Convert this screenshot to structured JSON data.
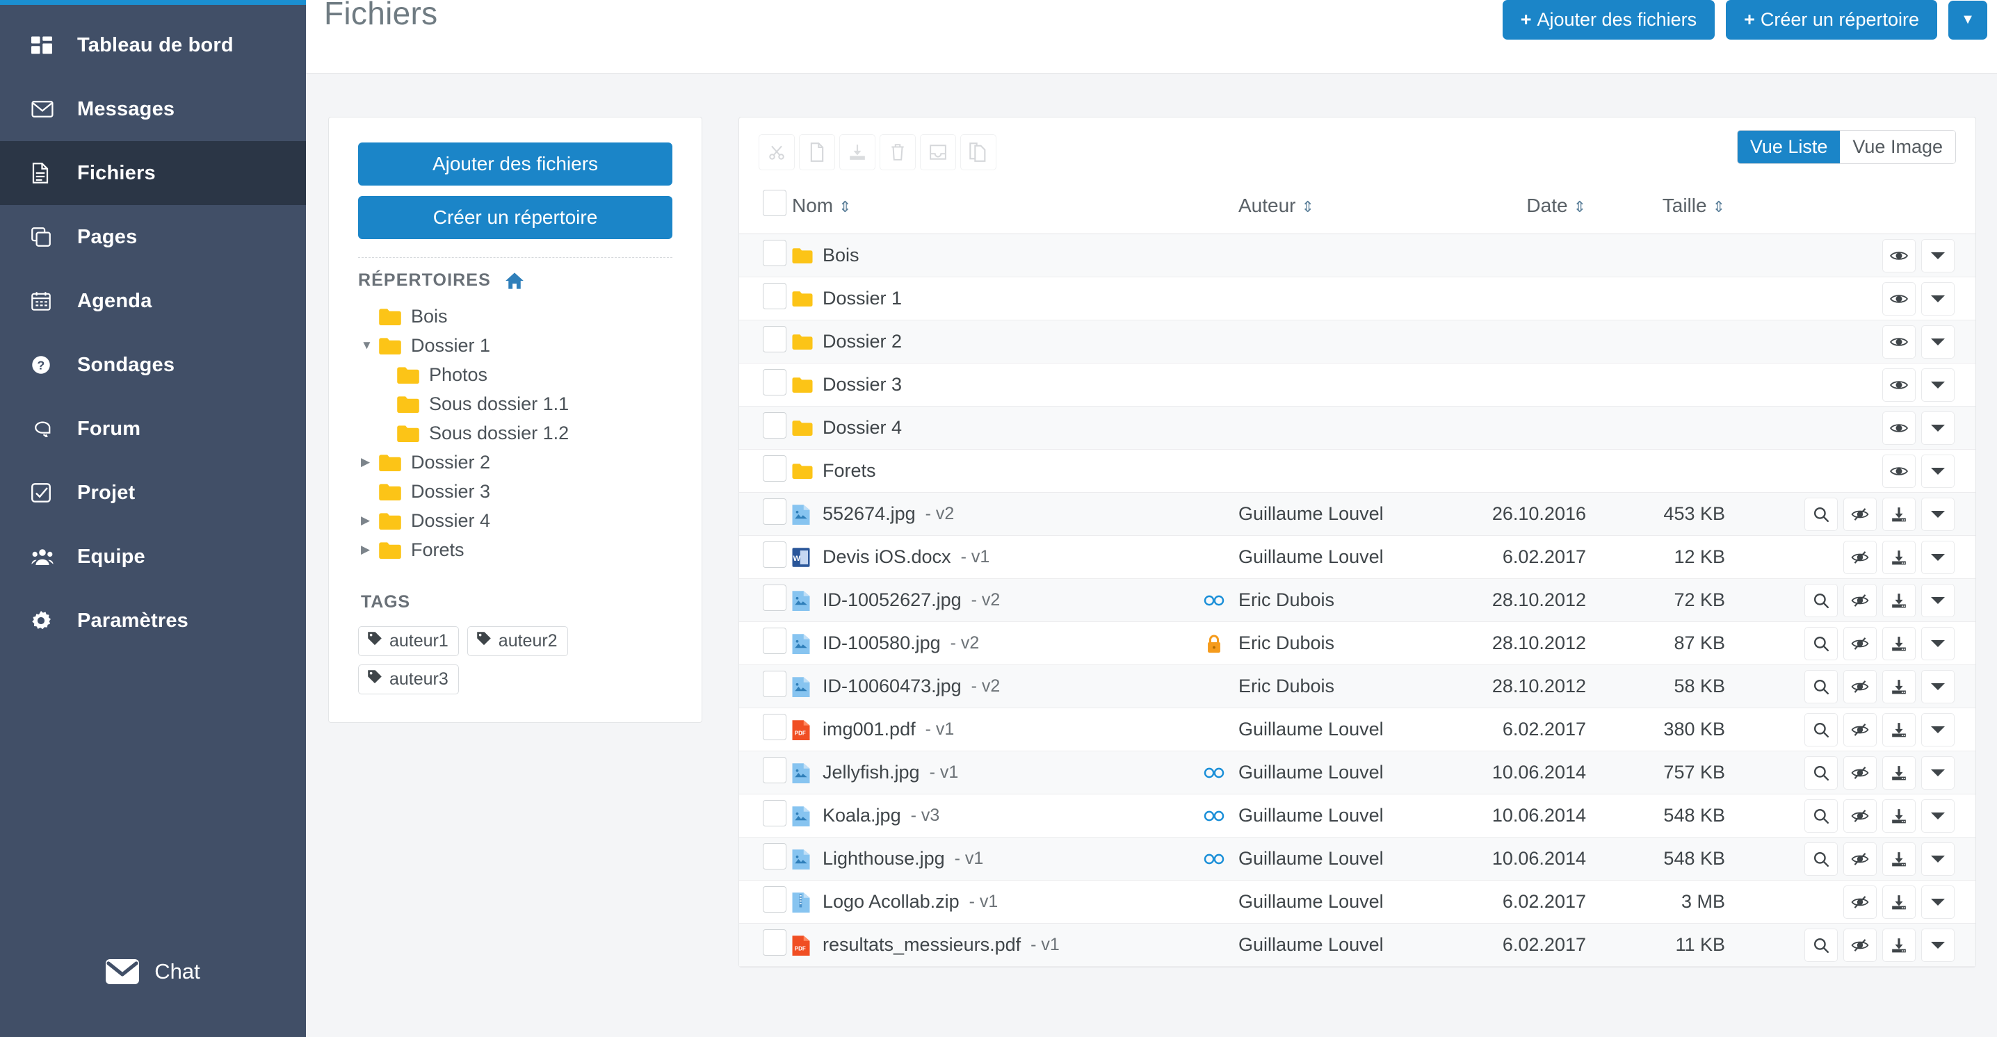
{
  "colors": {
    "sidebar_bg": "#414f67",
    "sidebar_active_bg": "#2b3646",
    "accent_blue": "#1b85c8",
    "top_accent": "#1b8fd1",
    "folder_yellow": "#fcc417",
    "lock_orange": "#f59b1c",
    "link_blue": "#1a8fd8"
  },
  "sidebar": {
    "items": [
      {
        "label": "Tableau de bord",
        "icon": "dashboard-icon",
        "active": false
      },
      {
        "label": "Messages",
        "icon": "envelope-icon",
        "active": false
      },
      {
        "label": "Fichiers",
        "icon": "file-icon",
        "active": true
      },
      {
        "label": "Pages",
        "icon": "pages-icon",
        "active": false
      },
      {
        "label": "Agenda",
        "icon": "calendar-icon",
        "active": false
      },
      {
        "label": "Sondages",
        "icon": "question-icon",
        "active": false
      },
      {
        "label": "Forum",
        "icon": "comments-icon",
        "active": false
      },
      {
        "label": "Projet",
        "icon": "checkbox-icon",
        "active": false
      },
      {
        "label": "Equipe",
        "icon": "users-icon",
        "active": false
      },
      {
        "label": "Paramètres",
        "icon": "gear-icon",
        "active": false
      }
    ],
    "chat": {
      "label": "Chat",
      "icon": "envelope-icon"
    }
  },
  "header": {
    "title": "Fichiers",
    "add_files_label": "Ajouter des fichiers",
    "create_dir_label": "Créer un répertoire",
    "plus": "+",
    "caret": "▼"
  },
  "leftcard": {
    "add_files_label": "Ajouter des fichiers",
    "create_dir_label": "Créer un répertoire",
    "dirs_heading": "RÉPERTOIRES",
    "home_icon": "home-icon",
    "tree": [
      {
        "label": "Bois",
        "level": 0,
        "caret": ""
      },
      {
        "label": "Dossier 1",
        "level": 0,
        "caret": "▼"
      },
      {
        "label": "Photos",
        "level": 1,
        "caret": ""
      },
      {
        "label": "Sous dossier 1.1",
        "level": 1,
        "caret": ""
      },
      {
        "label": "Sous dossier 1.2",
        "level": 1,
        "caret": ""
      },
      {
        "label": "Dossier 2",
        "level": 0,
        "caret": "▶"
      },
      {
        "label": "Dossier 3",
        "level": 0,
        "caret": ""
      },
      {
        "label": "Dossier 4",
        "level": 0,
        "caret": "▶"
      },
      {
        "label": "Forets",
        "level": 0,
        "caret": "▶"
      }
    ],
    "tags_heading": "TAGS",
    "tags": [
      "auteur1",
      "auteur2",
      "auteur3"
    ]
  },
  "filepanel": {
    "toolbar_icons": [
      "cut-icon",
      "copy-icon",
      "download-icon",
      "trash-icon",
      "archive-icon",
      "duplicate-icon"
    ],
    "view_list_label": "Vue Liste",
    "view_image_label": "Vue Image",
    "view_selected": "Vue Liste",
    "columns": {
      "name": "Nom",
      "author": "Auteur",
      "date": "Date",
      "size": "Taille",
      "sort_glyph": "⇕"
    },
    "rows": [
      {
        "kind": "folder",
        "name": "Bois",
        "version": "",
        "ftype": "folder",
        "flag": "",
        "author": "",
        "date": "",
        "size": "",
        "actions": [
          "eye-icon",
          "caret-down-icon"
        ]
      },
      {
        "kind": "folder",
        "name": "Dossier 1",
        "version": "",
        "ftype": "folder",
        "flag": "",
        "author": "",
        "date": "",
        "size": "",
        "actions": [
          "eye-icon",
          "caret-down-icon"
        ]
      },
      {
        "kind": "folder",
        "name": "Dossier 2",
        "version": "",
        "ftype": "folder",
        "flag": "",
        "author": "",
        "date": "",
        "size": "",
        "actions": [
          "eye-icon",
          "caret-down-icon"
        ]
      },
      {
        "kind": "folder",
        "name": "Dossier 3",
        "version": "",
        "ftype": "folder",
        "flag": "",
        "author": "",
        "date": "",
        "size": "",
        "actions": [
          "eye-icon",
          "caret-down-icon"
        ]
      },
      {
        "kind": "folder",
        "name": "Dossier 4",
        "version": "",
        "ftype": "folder",
        "flag": "",
        "author": "",
        "date": "",
        "size": "",
        "actions": [
          "eye-icon",
          "caret-down-icon"
        ]
      },
      {
        "kind": "folder",
        "name": "Forets",
        "version": "",
        "ftype": "folder",
        "flag": "",
        "author": "",
        "date": "",
        "size": "",
        "actions": [
          "eye-icon",
          "caret-down-icon"
        ]
      },
      {
        "kind": "file",
        "name": "552674.jpg",
        "version": "- v2",
        "ftype": "image",
        "flag": "",
        "author": "Guillaume Louvel",
        "date": "26.10.2016",
        "size": "453 KB",
        "actions": [
          "search-icon",
          "eye-slash-icon",
          "download-icon",
          "caret-down-icon"
        ]
      },
      {
        "kind": "file",
        "name": "Devis iOS.docx",
        "version": "- v1",
        "ftype": "word",
        "flag": "",
        "author": "Guillaume Louvel",
        "date": "6.02.2017",
        "size": "12 KB",
        "actions": [
          "spacer",
          "eye-slash-icon",
          "download-icon",
          "caret-down-icon"
        ]
      },
      {
        "kind": "file",
        "name": "ID-10052627.jpg",
        "version": "- v2",
        "ftype": "image",
        "flag": "link",
        "author": "Eric Dubois",
        "date": "28.10.2012",
        "size": "72 KB",
        "actions": [
          "search-icon",
          "eye-slash-icon",
          "download-icon",
          "caret-down-icon"
        ]
      },
      {
        "kind": "file",
        "name": "ID-100580.jpg",
        "version": "- v2",
        "ftype": "image",
        "flag": "lock",
        "author": "Eric Dubois",
        "date": "28.10.2012",
        "size": "87 KB",
        "actions": [
          "search-icon",
          "eye-slash-icon",
          "download-icon",
          "caret-down-icon"
        ]
      },
      {
        "kind": "file",
        "name": "ID-10060473.jpg",
        "version": "- v2",
        "ftype": "image",
        "flag": "",
        "author": "Eric Dubois",
        "date": "28.10.2012",
        "size": "58 KB",
        "actions": [
          "search-icon",
          "eye-slash-icon",
          "download-icon",
          "caret-down-icon"
        ]
      },
      {
        "kind": "file",
        "name": "img001.pdf",
        "version": "- v1",
        "ftype": "pdf",
        "flag": "",
        "author": "Guillaume Louvel",
        "date": "6.02.2017",
        "size": "380 KB",
        "actions": [
          "search-icon",
          "eye-slash-icon",
          "download-icon",
          "caret-down-icon"
        ]
      },
      {
        "kind": "file",
        "name": "Jellyfish.jpg",
        "version": "- v1",
        "ftype": "image",
        "flag": "link",
        "author": "Guillaume Louvel",
        "date": "10.06.2014",
        "size": "757 KB",
        "actions": [
          "search-icon",
          "eye-slash-icon",
          "download-icon",
          "caret-down-icon"
        ]
      },
      {
        "kind": "file",
        "name": "Koala.jpg",
        "version": "- v3",
        "ftype": "image",
        "flag": "link",
        "author": "Guillaume Louvel",
        "date": "10.06.2014",
        "size": "548 KB",
        "actions": [
          "search-icon",
          "eye-slash-icon",
          "download-icon",
          "caret-down-icon"
        ]
      },
      {
        "kind": "file",
        "name": "Lighthouse.jpg",
        "version": "- v1",
        "ftype": "image",
        "flag": "link",
        "author": "Guillaume Louvel",
        "date": "10.06.2014",
        "size": "548 KB",
        "actions": [
          "search-icon",
          "eye-slash-icon",
          "download-icon",
          "caret-down-icon"
        ]
      },
      {
        "kind": "file",
        "name": "Logo Acollab.zip",
        "version": "- v1",
        "ftype": "zip",
        "flag": "",
        "author": "Guillaume Louvel",
        "date": "6.02.2017",
        "size": "3 MB",
        "actions": [
          "spacer",
          "eye-slash-icon",
          "download-icon",
          "caret-down-icon"
        ]
      },
      {
        "kind": "file",
        "name": "resultats_messieurs.pdf",
        "version": "- v1",
        "ftype": "pdf",
        "flag": "",
        "author": "Guillaume Louvel",
        "date": "6.02.2017",
        "size": "11 KB",
        "actions": [
          "search-icon",
          "eye-slash-icon",
          "download-icon",
          "caret-down-icon"
        ]
      }
    ]
  }
}
